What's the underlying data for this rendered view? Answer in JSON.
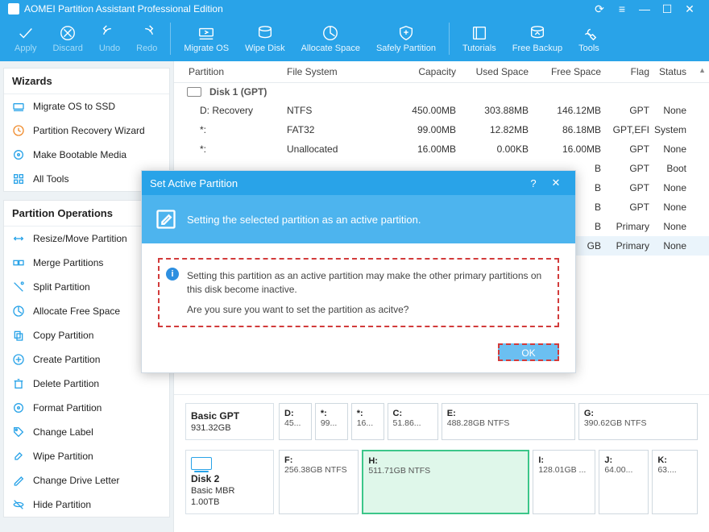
{
  "title": "AOMEI Partition Assistant Professional Edition",
  "toolbar": {
    "apply": "Apply",
    "discard": "Discard",
    "undo": "Undo",
    "redo": "Redo",
    "migrate": "Migrate OS",
    "wipe": "Wipe Disk",
    "allocate": "Allocate Space",
    "safely": "Safely Partition",
    "tutorials": "Tutorials",
    "backup": "Free Backup",
    "tools": "Tools"
  },
  "sidebar": {
    "wizards_title": "Wizards",
    "wizards": [
      "Migrate OS to SSD",
      "Partition Recovery Wizard",
      "Make Bootable Media",
      "All Tools"
    ],
    "ops_title": "Partition Operations",
    "ops": [
      "Resize/Move Partition",
      "Merge Partitions",
      "Split Partition",
      "Allocate Free Space",
      "Copy Partition",
      "Create Partition",
      "Delete Partition",
      "Format Partition",
      "Change Label",
      "Wipe Partition",
      "Change Drive Letter",
      "Hide Partition"
    ]
  },
  "grid": {
    "headers": {
      "partition": "Partition",
      "fs": "File System",
      "capacity": "Capacity",
      "used": "Used Space",
      "free": "Free Space",
      "flag": "Flag",
      "status": "Status"
    },
    "disk1_label": "Disk 1 (GPT)",
    "rows": [
      {
        "p": "D: Recovery",
        "fs": "NTFS",
        "cap": "450.00MB",
        "used": "303.88MB",
        "free": "146.12MB",
        "flag": "GPT",
        "stat": "None"
      },
      {
        "p": "*:",
        "fs": "FAT32",
        "cap": "99.00MB",
        "used": "12.82MB",
        "free": "86.18MB",
        "flag": "GPT,EFI",
        "stat": "System"
      },
      {
        "p": "*:",
        "fs": "Unallocated",
        "cap": "16.00MB",
        "used": "0.00KB",
        "free": "16.00MB",
        "flag": "GPT",
        "stat": "None"
      }
    ],
    "tail": [
      {
        "cap": "B",
        "flag": "GPT",
        "stat": "Boot"
      },
      {
        "cap": "B",
        "flag": "GPT",
        "stat": "None"
      },
      {
        "cap": "B",
        "flag": "GPT",
        "stat": "None"
      },
      {
        "cap": "B",
        "flag": "Primary",
        "stat": "None"
      },
      {
        "cap": "GB",
        "flag": "Primary",
        "stat": "None"
      }
    ]
  },
  "diskview": {
    "d1": {
      "label": "Basic GPT",
      "size": "931.32GB",
      "parts": [
        {
          "l": "D:",
          "s": "45..."
        },
        {
          "l": "*:",
          "s": "99..."
        },
        {
          "l": "*:",
          "s": "16..."
        },
        {
          "l": "C:",
          "s": "51.86..."
        },
        {
          "l": "E:",
          "s": "488.28GB NTFS"
        },
        {
          "l": "G:",
          "s": "390.62GB NTFS"
        }
      ]
    },
    "d2": {
      "name": "Disk 2",
      "label": "Basic MBR",
      "size": "1.00TB",
      "parts": [
        {
          "l": "F:",
          "s": "256.38GB NTFS"
        },
        {
          "l": "H:",
          "s": "511.71GB NTFS",
          "sel": true
        },
        {
          "l": "I:",
          "s": "128.01GB ..."
        },
        {
          "l": "J:",
          "s": "64.00..."
        },
        {
          "l": "K:",
          "s": "63...."
        }
      ]
    }
  },
  "modal": {
    "title": "Set Active Partition",
    "subtitle": "Setting the selected partition as an active partition.",
    "warn1": "Setting this partition as an active partition may make the other primary partitions on this disk become inactive.",
    "warn2": "Are you sure you want to set the partition as acitve?",
    "ok": "OK"
  }
}
